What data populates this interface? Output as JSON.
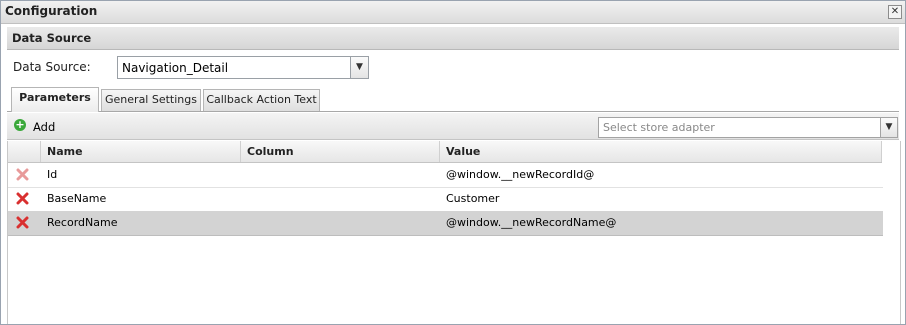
{
  "window": {
    "title": "Configuration",
    "close_glyph": "✕"
  },
  "section": {
    "title": "Data Source"
  },
  "datasource": {
    "label": "Data Source:",
    "value": "Navigation_Detail"
  },
  "tabs": [
    {
      "label": "Parameters",
      "active": true
    },
    {
      "label": "General Settings",
      "active": false
    },
    {
      "label": "Callback Action Text",
      "active": false
    }
  ],
  "toolbar": {
    "add_label": "Add",
    "add_icon": "add-circle-icon",
    "store_placeholder": "Select store adapter"
  },
  "grid": {
    "columns": [
      "Name",
      "Column",
      "Value"
    ],
    "rows": [
      {
        "name": "Id",
        "column": "",
        "value": "@window.__newRecordId@",
        "selected": false
      },
      {
        "name": "BaseName",
        "column": "",
        "value": "Customer",
        "selected": false
      },
      {
        "name": "RecordName",
        "column": "",
        "value": "@window.__newRecordName@",
        "selected": true
      }
    ]
  },
  "colors": {
    "delete_icon": "#d93030",
    "add_icon": "#3aa83a",
    "selected_row": "#d3d3d3"
  }
}
